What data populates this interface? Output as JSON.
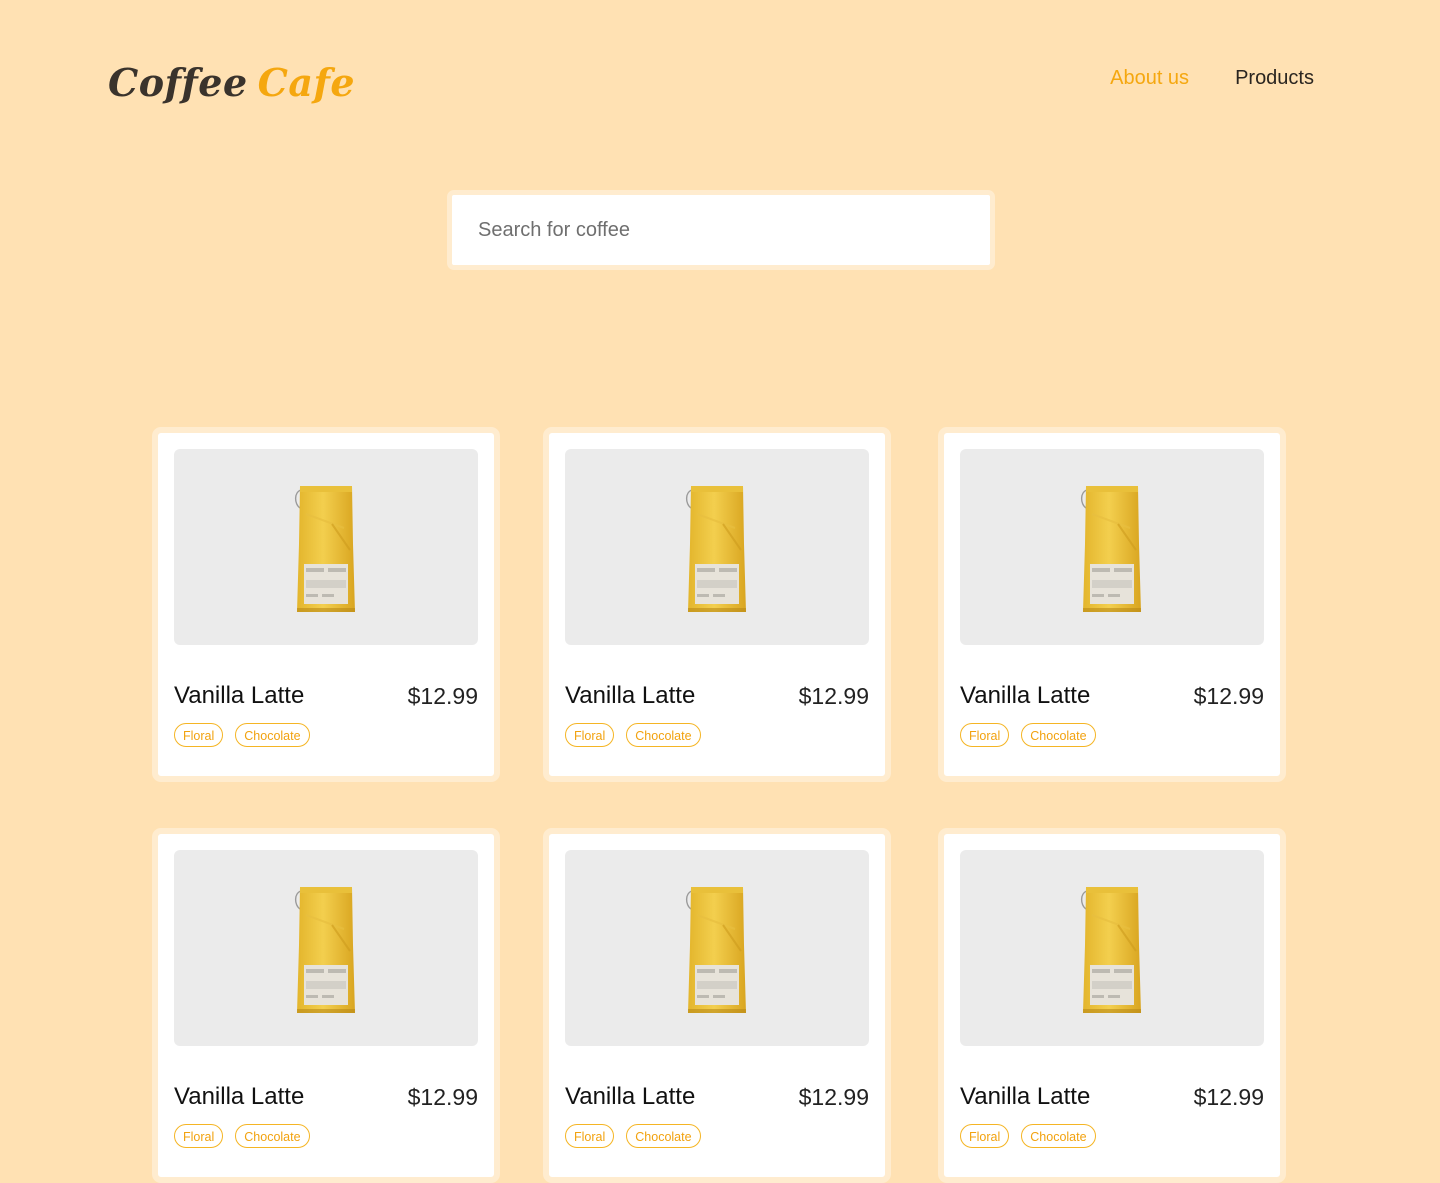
{
  "brand": {
    "word1": "Coffee",
    "word2": "Cafe"
  },
  "nav": {
    "about": "About us",
    "products": "Products"
  },
  "search": {
    "placeholder": "Search for coffee"
  },
  "colors": {
    "background": "#FFE1B3",
    "accent": "#F5A70F",
    "card_border": "#FFECCF",
    "image_placeholder": "#EBEBEB"
  },
  "products": [
    {
      "name": "Vanilla Latte",
      "price": "$12.99",
      "tags": [
        "Floral",
        "Chocolate"
      ],
      "image": "coffee-bag-icon"
    },
    {
      "name": "Vanilla Latte",
      "price": "$12.99",
      "tags": [
        "Floral",
        "Chocolate"
      ],
      "image": "coffee-bag-icon"
    },
    {
      "name": "Vanilla Latte",
      "price": "$12.99",
      "tags": [
        "Floral",
        "Chocolate"
      ],
      "image": "coffee-bag-icon"
    },
    {
      "name": "Vanilla Latte",
      "price": "$12.99",
      "tags": [
        "Floral",
        "Chocolate"
      ],
      "image": "coffee-bag-icon"
    },
    {
      "name": "Vanilla Latte",
      "price": "$12.99",
      "tags": [
        "Floral",
        "Chocolate"
      ],
      "image": "coffee-bag-icon"
    },
    {
      "name": "Vanilla Latte",
      "price": "$12.99",
      "tags": [
        "Floral",
        "Chocolate"
      ],
      "image": "coffee-bag-icon"
    }
  ]
}
